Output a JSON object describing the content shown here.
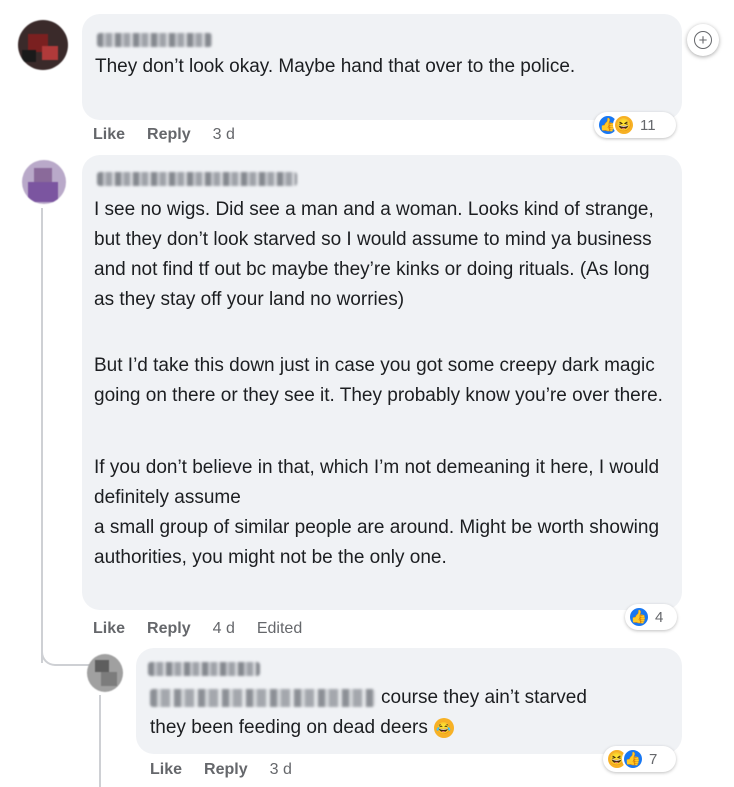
{
  "actions": {
    "like": "Like",
    "reply": "Reply"
  },
  "comments": [
    {
      "time": "3 d",
      "edited": "",
      "paragraphs": [
        "They don’t look okay. Maybe hand that over to the police."
      ],
      "reactions": {
        "icons": [
          "like",
          "haha"
        ],
        "count": "11"
      }
    },
    {
      "time": "4 d",
      "edited": "Edited",
      "paragraphs": [
        "I see no wigs. Did see a man and a woman. Looks kind of strange, but they don’t look starved so I would assume to mind ya business and not find tf out bc maybe they’re kinks or doing rituals. (As long as they stay off your land no worries)",
        "But I’d take this down just in case you got some creepy dark magic going on there or they see it. They probably know you’re over there.",
        "If you don’t believe in that, which I’m not demeaning it here, I would definitely assume",
        "a small group of similar people are around. Might be worth showing authorities, you might not be the only one."
      ],
      "reactions": {
        "icons": [
          "like"
        ],
        "count": "4"
      }
    }
  ],
  "reply": {
    "time": "3 d",
    "line1": "course they ain’t starved",
    "line2": "they been feeding on dead deers",
    "reactions": {
      "icons": [
        "haha",
        "like"
      ],
      "count": "7"
    }
  },
  "icons": {
    "add": "add-reaction-icon",
    "like": "like-reaction-icon",
    "haha": "haha-reaction-icon",
    "inline": "laughing-emoji-icon"
  },
  "colors": {
    "bubble": "#f0f2f5",
    "meta": "#65676b",
    "like": "#1877f2",
    "haha": "#f7b125"
  }
}
